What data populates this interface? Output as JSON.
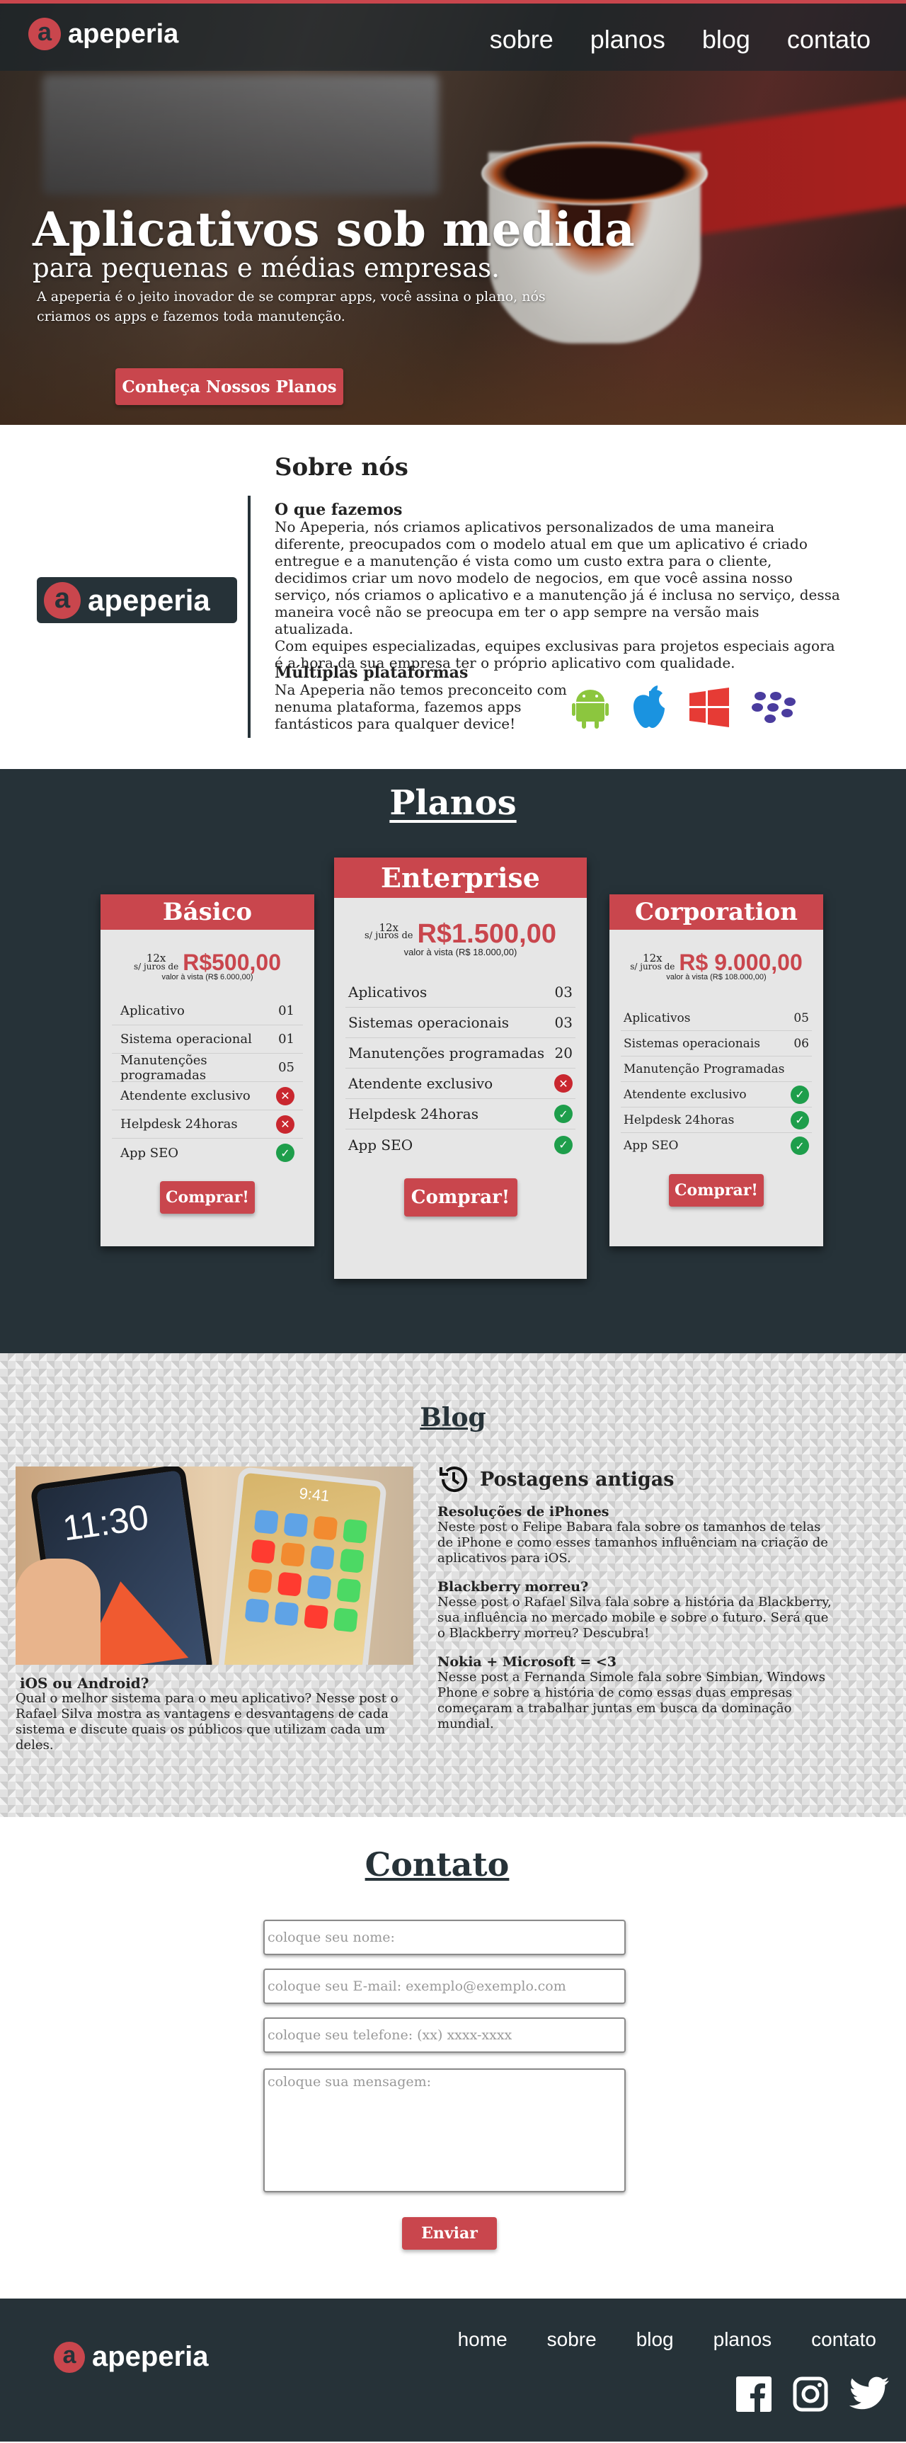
{
  "colors": {
    "accent": "#c9464d",
    "dark": "#263238",
    "check_yes": "#1e9e4b",
    "check_no": "#c9272f"
  },
  "brand": {
    "logo_letter": "a",
    "name": "apeperia"
  },
  "nav": [
    "sobre",
    "planos",
    "blog",
    "contato"
  ],
  "hero": {
    "title": "Aplicativos sob medida",
    "subtitle": "para pequenas e médias empresas.",
    "description": "A apeperia é o jeito inovador de se comprar apps, você assina o plano, nós criamos os apps e fazemos toda manutenção.",
    "cta": "Conheça Nossos Planos"
  },
  "about": {
    "title": "Sobre nós",
    "what_heading": "O que fazemos",
    "what_text": "No Apeperia, nós criamos aplicativos personalizados de uma maneira diferente, preocupados com o modelo atual em que um aplicativo é criado entregue e a manutenção é vista como um custo extra para o cliente, decidimos criar um novo modelo de negocios, em que você assina nosso serviço, nós criamos o aplicativo e a manutenção já é inclusa no serviço, dessa maneira você não se preocupa em ter o app sempre na versão mais atualizada.",
    "what_text2": "Com equipes especializadas, equipes exclusivas para projetos especiais agora é a hora da sua empresa ter o próprio aplicativo com qualidade.",
    "platforms_heading": "Múltiplas plataformas",
    "platforms_text": "Na Apeperia não temos preconceito com nenuma plataforma, fazemos apps fantásticos para qualquer device!",
    "platform_icons": [
      "android-icon",
      "apple-icon",
      "windows-icon",
      "blackberry-icon"
    ]
  },
  "plans": {
    "title": "Planos",
    "items": [
      {
        "name": "Básico",
        "installments": "12x",
        "interest": "s/ juros de",
        "price": "R$500,00",
        "cash": "valor à vista (R$ 6.000,00)",
        "features": [
          {
            "label": "Aplicativo",
            "value": "01"
          },
          {
            "label": "Sistema operacional",
            "value": "01"
          },
          {
            "label": "Manutenções programadas",
            "value": "05"
          },
          {
            "label": "Atendente exclusivo",
            "check": false
          },
          {
            "label": "Helpdesk 24horas",
            "check": false
          },
          {
            "label": "App SEO",
            "check": true
          }
        ],
        "button": "Comprar!"
      },
      {
        "name": "Enterprise",
        "installments": "12x",
        "interest": "s/ juros de",
        "price": "R$1.500,00",
        "cash": "valor à vista (R$ 18.000,00)",
        "features": [
          {
            "label": "Aplicativos",
            "value": "03"
          },
          {
            "label": "Sistemas operacionais",
            "value": "03"
          },
          {
            "label": "Manutenções programadas",
            "value": "20"
          },
          {
            "label": "Atendente exclusivo",
            "check": false
          },
          {
            "label": "Helpdesk 24horas",
            "check": true
          },
          {
            "label": "App SEO",
            "check": true
          }
        ],
        "button": "Comprar!"
      },
      {
        "name": "Corporation",
        "installments": "12x",
        "interest": "s/ juros de",
        "price": "R$ 9.000,00",
        "cash": "valor à vista (R$ 108.000,00)",
        "features": [
          {
            "label": "Aplicativos",
            "value": "05"
          },
          {
            "label": "Sistemas operacionais",
            "value": "06"
          },
          {
            "label": "Manutenção Programadas",
            "value": ""
          },
          {
            "label": "Atendente exclusivo",
            "check": true
          },
          {
            "label": "Helpdesk 24horas",
            "check": true
          },
          {
            "label": "App SEO",
            "check": true
          }
        ],
        "button": "Comprar!"
      }
    ]
  },
  "blog": {
    "title": "Blog",
    "main_post": {
      "title": "iOS ou Android?",
      "text": "Qual o melhor sistema para o meu aplicativo? Nesse post o Rafael Silva mostra as vantagens e desvantagens de cada sistema e discute quais os públicos que utilizam cada um deles.",
      "image_time_a": "11:30",
      "image_time_b": "9:41"
    },
    "older_title": "Postagens antigas",
    "older": [
      {
        "title": "Resoluções de iPhones",
        "text": "Neste post o Felipe Babara fala sobre os tamanhos de telas de iPhone e como esses tamanhos influênciam na criação de aplicativos para iOS."
      },
      {
        "title": "Blackberry morreu?",
        "text": "Nesse post o Rafael Silva fala sobre a história da Blackberry, sua influência no mercado mobile e sobre o futuro. Será que o Blackberry morreu? Descubra!"
      },
      {
        "title": "Nokia + Microsoft = <3",
        "text": "Nesse post a Fernanda Simole fala sobre Simbian, Windows Phone e sobre a história de como essas duas empresas começaram a trabalhar juntas em busca da dominação mundial."
      }
    ]
  },
  "contact": {
    "title": "Contato",
    "name_placeholder": "coloque seu nome:",
    "email_placeholder": "coloque seu E-mail: exemplo@exemplo.com",
    "phone_placeholder": "coloque seu telefone: (xx) xxxx-xxxx",
    "message_placeholder": "coloque sua mensagem:",
    "submit": "Enviar"
  },
  "footer": {
    "nav": [
      "home",
      "sobre",
      "blog",
      "planos",
      "contato"
    ],
    "social": [
      "facebook-icon",
      "instagram-icon",
      "twitter-icon"
    ]
  }
}
